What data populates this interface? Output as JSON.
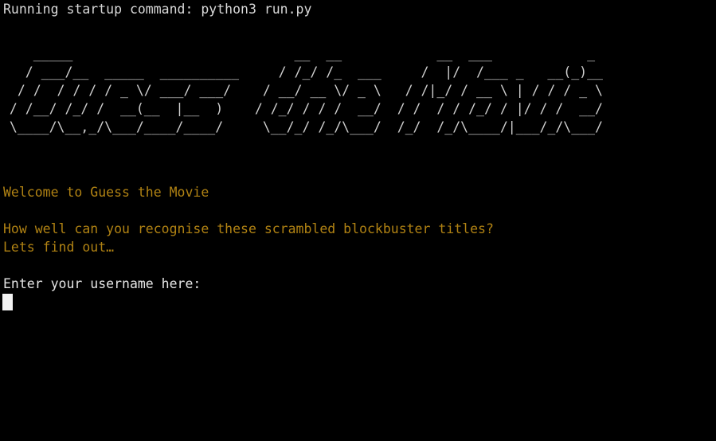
{
  "terminal": {
    "background_color": "#000000",
    "default_text_color": "#d8d8d8",
    "accent_color": "#b08213",
    "cursor_color": "#f2f2f2",
    "startup_line": "Running startup command: python3 run.py",
    "ascii_banner": "    _____                            __  __            __  ___            _      \n   / ___/__  _____  __________     / /_/ /_  ___     /  |/  /___ _   __(_)__   \n  / /  / / / / _ \\/ ___/ ___/    / __/ __ \\/ _ \\   / /|_/ / __ \\ | / / / _ \\ \n / /__/ /_/ /  __(__  |__  )    / /_/ / / /  __/  / /  / / /_/ / |/ / /  __/ \n \\____/\\__,_/\\___/____/____/     \\__/_/ /_/\\___/  /_/  /_/\\____/|___/_/\\___/  ",
    "welcome_message": "Welcome to Guess the Movie",
    "question_line": "How well can you recognise these scrambled blockbuster titles?",
    "lets_find_out_line": "Lets find out…",
    "prompt_label": "Enter your username here:",
    "input_value": "",
    "input_placeholder": ""
  }
}
